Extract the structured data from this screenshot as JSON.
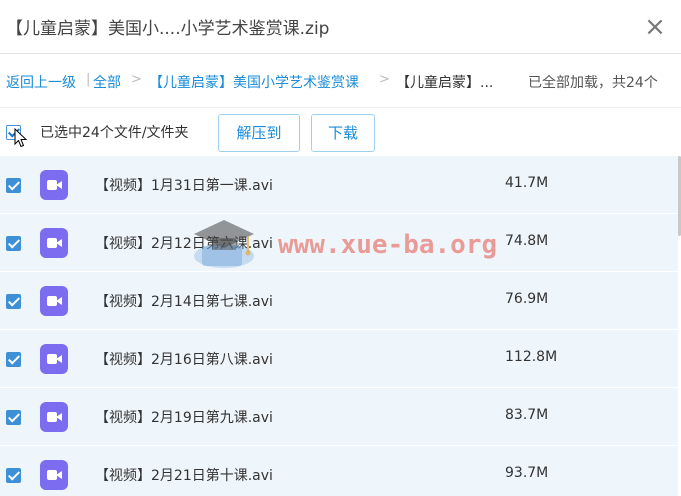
{
  "window": {
    "title": "【儿童启蒙】美国小....小学艺术鉴赏课.zip"
  },
  "breadcrumb": {
    "back": "返回上一级",
    "all": "全部",
    "folder": "【儿童启蒙】美国小学艺术鉴赏课",
    "current": "【儿童启蒙】...",
    "status": "已全部加载，共24个"
  },
  "toolbar": {
    "selected_label": "已选中24个文件/文件夹",
    "extract_label": "解压到",
    "download_label": "下载"
  },
  "files": [
    {
      "name": "【视频】1月31日第一课.avi",
      "size": "41.7M"
    },
    {
      "name": "【视频】2月12日第六课.avi",
      "size": "74.8M"
    },
    {
      "name": "【视频】2月14日第七课.avi",
      "size": "76.9M"
    },
    {
      "name": "【视频】2月16日第八课.avi",
      "size": "112.8M"
    },
    {
      "name": "【视频】2月19日第九课.avi",
      "size": "83.7M"
    },
    {
      "name": "【视频】2月21日第十课.avi",
      "size": "93.7M"
    }
  ],
  "watermark": {
    "text": "www.xue-ba.org"
  },
  "colors": {
    "link": "#1a8cd8",
    "row_bg": "#eef6fc",
    "checkbox": "#3d8fd6",
    "video_icon": "#7b6cf0"
  },
  "icons": {
    "close": "close-icon",
    "video": "video-file-icon",
    "cursor": "mouse-cursor-icon"
  }
}
